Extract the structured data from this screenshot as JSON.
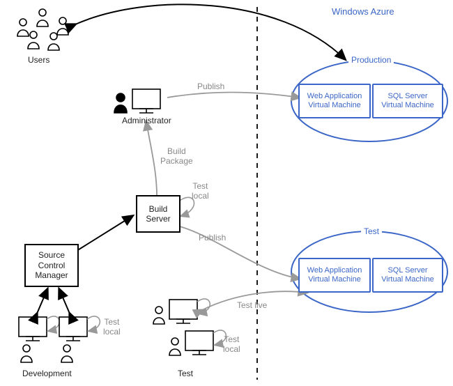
{
  "title": "Windows Azure",
  "users_label": "Users",
  "admin_label": "Administrator",
  "build_server_label": "Build\nServer",
  "source_control_label": "Source\nControl\nManager",
  "dev_label": "Development",
  "test_label": "Test",
  "publish_label": "Publish",
  "build_package_label": "Build\nPackage",
  "test_local_label": "Test\nlocal",
  "test_live_label": "Test live",
  "production_group_label": "Production",
  "test_group_label": "Test",
  "web_app_vm_label": "Web Application\nVirtual Machine",
  "sql_vm_label": "SQL Server\nVirtual Machine"
}
